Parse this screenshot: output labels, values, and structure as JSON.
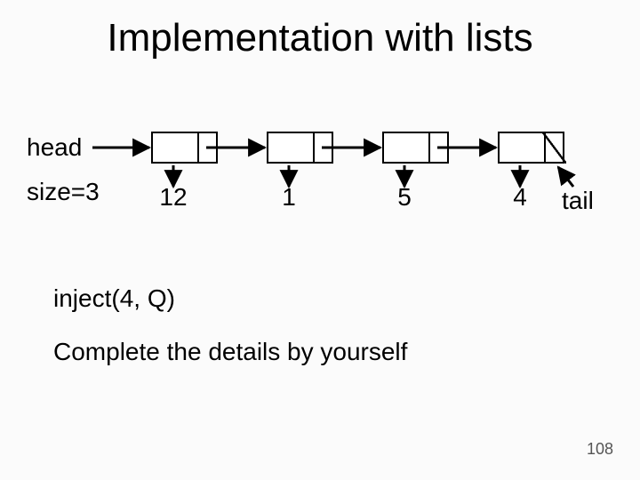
{
  "title": "Implementation with lists",
  "labels": {
    "head": "head",
    "size": "size=3",
    "tail": "tail"
  },
  "nodes": [
    {
      "value": "12"
    },
    {
      "value": "1"
    },
    {
      "value": "5"
    },
    {
      "value": "4",
      "null_next": true
    }
  ],
  "inject": "inject(4, Q)",
  "complete": "Complete the details by yourself",
  "page_number": "108",
  "chart_data": {
    "type": "diagram",
    "structure": "singly-linked-list",
    "head_pointer": 0,
    "tail_pointer": 3,
    "size_shown": 3,
    "values": [
      12,
      1,
      5,
      4
    ],
    "operation": "inject(4, Q)"
  }
}
